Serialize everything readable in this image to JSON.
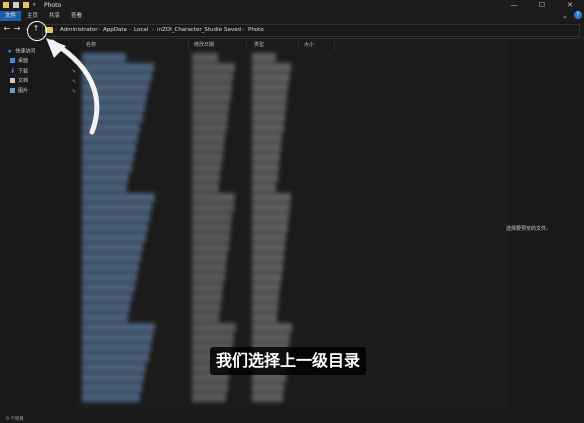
{
  "window": {
    "title": "Photo",
    "min_icon": "minimize-icon",
    "max_icon": "maximize-icon",
    "close_icon": "close-icon"
  },
  "ribbon": {
    "tabs": [
      "文件",
      "主页",
      "共享",
      "查看"
    ],
    "active_tab": 0
  },
  "breadcrumb": [
    "Administrator",
    "AppData",
    "Local",
    "inZOI_Character_Studio",
    "Saved",
    "Photo"
  ],
  "sidebar": {
    "items": [
      {
        "label": "快速访问",
        "icon": "star-icon"
      },
      {
        "label": "桌面",
        "icon": "desktop-icon"
      },
      {
        "label": "下载",
        "icon": "download-icon"
      },
      {
        "label": "文档",
        "icon": "document-icon"
      },
      {
        "label": "图片",
        "icon": "picture-icon"
      }
    ]
  },
  "columns": [
    "名称",
    "修改日期",
    "类型",
    "大小"
  ],
  "preview": {
    "empty_text": "选择要预览的文件。"
  },
  "status": {
    "items_text": "0 个项目"
  },
  "subtitle": "我们选择上一级目录",
  "colors": {
    "accent": "#1d5fa8",
    "folder": "#e8c25c",
    "background": "#191919"
  }
}
